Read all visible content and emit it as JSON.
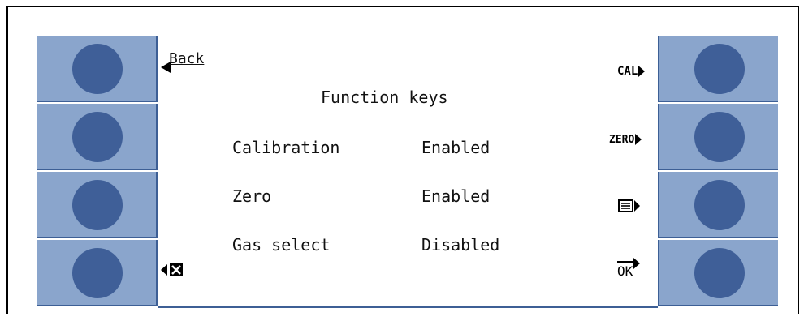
{
  "screen": {
    "back_label": "Back",
    "title": "Function keys",
    "rows": [
      {
        "name": "Calibration",
        "state": "Enabled"
      },
      {
        "name": "Zero",
        "state": "Enabled"
      },
      {
        "name": "Gas select",
        "state": "Disabled"
      }
    ],
    "softkeys": {
      "cal": "CAL",
      "zero": "ZERO",
      "ok": "OK"
    }
  },
  "colors": {
    "key_bg": "#8aa5cc",
    "knob": "#3f5f98",
    "border": "#3d5f95"
  },
  "icons": {
    "back": "back-arrow-icon",
    "cancel": "cancel-x-icon",
    "menu": "menu-list-icon"
  }
}
